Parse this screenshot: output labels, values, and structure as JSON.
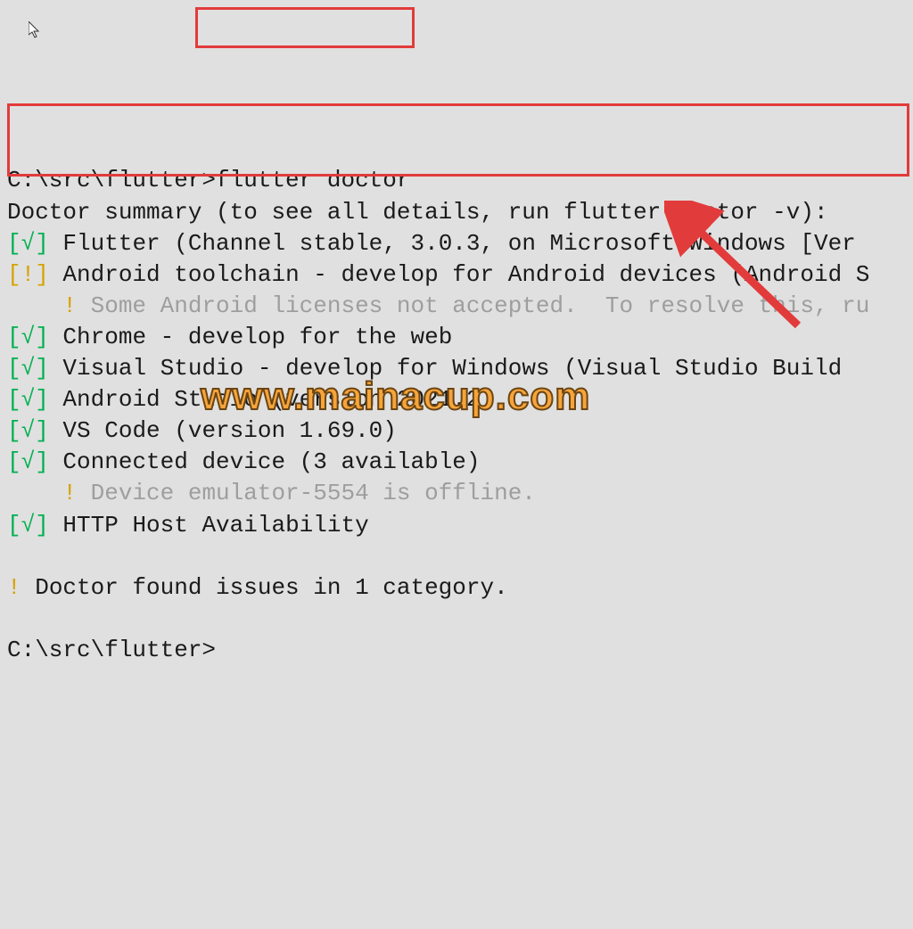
{
  "terminal": {
    "prompt_path": "C:\\src\\flutter>",
    "command": "flutter doctor",
    "summary_header": "Doctor summary (to see all details, run flutter doctor -v):",
    "check_ok_open": "[",
    "check_ok_mark": "√",
    "check_ok_close": "]",
    "check_warn_open": "[",
    "check_warn_mark": "!",
    "check_warn_close": "]",
    "line_flutter": " Flutter (Channel stable, 3.0.3, on Microsoft Windows [Ver",
    "line_android_toolchain": " Android toolchain - develop for Android devices (Android S",
    "warn_android_mark": "    !",
    "warn_android_text": " Some Android licenses not accepted.  To resolve this, ru",
    "line_chrome": " Chrome - develop for the web",
    "line_vs": " Visual Studio - develop for Windows (Visual Studio Build ",
    "line_android_studio": " Android Studio (version 2021.2)",
    "line_vscode": " VS Code (version 1.69.0)",
    "line_connected": " Connected device (3 available)",
    "warn_device_mark": "    !",
    "warn_device_text": " Device emulator-5554 is offline.",
    "line_http": " HTTP Host Availability",
    "footer_mark": "!",
    "footer_text": " Doctor found issues in 1 category.",
    "final_prompt": "C:\\src\\flutter>"
  },
  "watermark": "www.mainacup.com"
}
